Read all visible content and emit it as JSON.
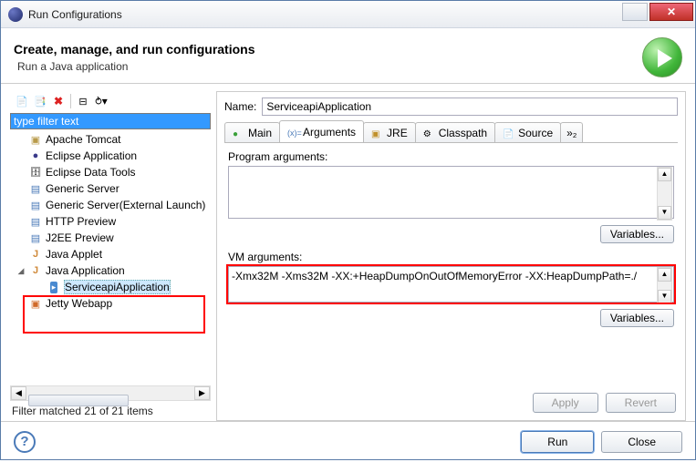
{
  "window": {
    "title": "Run Configurations"
  },
  "header": {
    "title": "Create, manage, and run configurations",
    "subtitle": "Run a Java application"
  },
  "toolbar": {
    "new": "New",
    "dup": "Duplicate",
    "del": "Delete",
    "collapse": "Collapse All",
    "expand": "Expand All"
  },
  "filter": {
    "placeholder": "type filter text"
  },
  "tree": {
    "items": [
      {
        "label": "Apache Tomcat",
        "icon": "tomcat"
      },
      {
        "label": "Eclipse Application",
        "icon": "eclipse"
      },
      {
        "label": "Eclipse Data Tools",
        "icon": "db"
      },
      {
        "label": "Generic Server",
        "icon": "server"
      },
      {
        "label": "Generic Server(External Launch)",
        "icon": "server"
      },
      {
        "label": "HTTP Preview",
        "icon": "server"
      },
      {
        "label": "J2EE Preview",
        "icon": "server"
      },
      {
        "label": "Java Applet",
        "icon": "java"
      },
      {
        "label": "Java Application",
        "icon": "java",
        "expanded": true
      },
      {
        "label": "ServiceapiApplication",
        "icon": "jrun",
        "child": true,
        "selected": true
      },
      {
        "label": "Jetty Webapp",
        "icon": "jetty"
      }
    ]
  },
  "filter_status": "Filter matched 21 of 21 items",
  "details": {
    "name_label": "Name:",
    "name_value": "ServiceapiApplication",
    "tabs": [
      {
        "label": "Main",
        "icon": "main"
      },
      {
        "label": "Arguments",
        "icon": "arg",
        "active": true
      },
      {
        "label": "JRE",
        "icon": "jre"
      },
      {
        "label": "Classpath",
        "icon": "cp"
      },
      {
        "label": "Source",
        "icon": "src"
      }
    ],
    "more_tabs": "»₂",
    "program_args_label": "Program arguments:",
    "program_args_value": "",
    "vm_args_label": "VM arguments:",
    "vm_args_value": "-Xmx32M -Xms32M -XX:+HeapDumpOnOutOfMemoryError -XX:HeapDumpPath=./",
    "variables_btn": "Variables...",
    "apply": "Apply",
    "revert": "Revert"
  },
  "footer": {
    "help": "?",
    "run": "Run",
    "close": "Close"
  }
}
